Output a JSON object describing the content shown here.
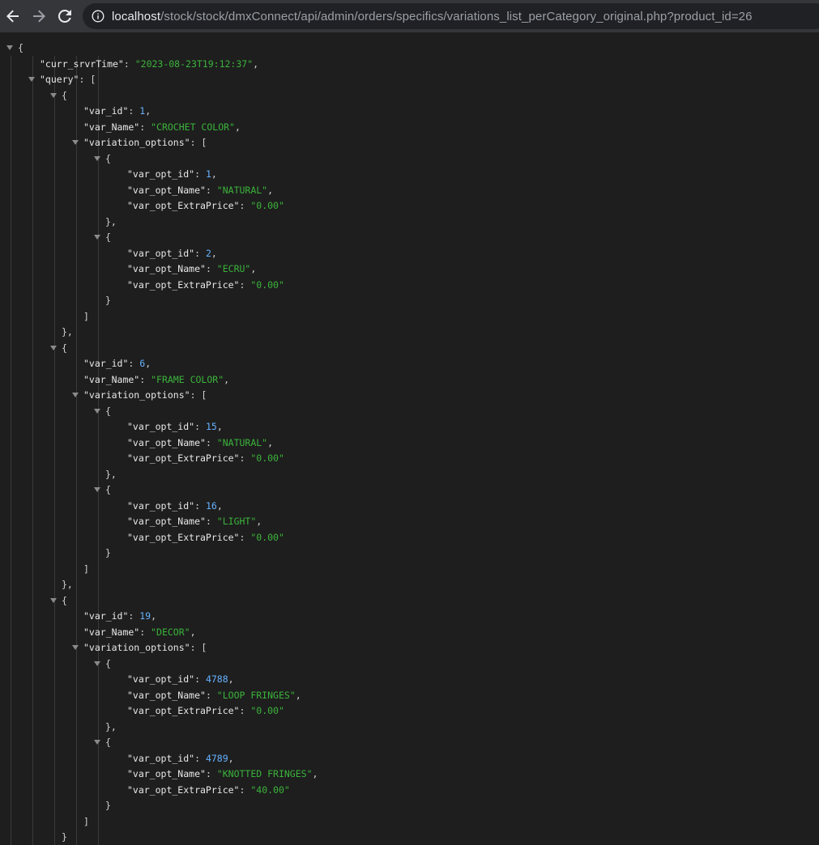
{
  "browser": {
    "url_host": "localhost",
    "url_path": "/stock/stock/dmxConnect/api/admin/orders/specifics/variations_list_perCategory_original.php?product_id=26"
  },
  "json": {
    "curr_srvrTime_key": "\"curr_srvrTime\"",
    "curr_srvrTime_value": "\"2023-08-23T19:12:37\"",
    "query_key": "\"query\"",
    "items": [
      {
        "var_id": "1",
        "var_Name": "\"CROCHET COLOR\"",
        "options": [
          {
            "id": "1",
            "name": "\"NATURAL\"",
            "price": "\"0.00\""
          },
          {
            "id": "2",
            "name": "\"ECRU\"",
            "price": "\"0.00\""
          }
        ]
      },
      {
        "var_id": "6",
        "var_Name": "\"FRAME COLOR\"",
        "options": [
          {
            "id": "15",
            "name": "\"NATURAL\"",
            "price": "\"0.00\""
          },
          {
            "id": "16",
            "name": "\"LIGHT\"",
            "price": "\"0.00\""
          }
        ]
      },
      {
        "var_id": "19",
        "var_Name": "\"DECOR\"",
        "options": [
          {
            "id": "4788",
            "name": "\"LOOP FRINGES\"",
            "price": "\"0.00\""
          },
          {
            "id": "4789",
            "name": "\"KNOTTED FRINGES\"",
            "price": "\"40.00\""
          }
        ]
      }
    ],
    "labels": {
      "var_id": "\"var_id\"",
      "var_Name": "\"var_Name\"",
      "variation_options": "\"variation_options\"",
      "var_opt_id": "\"var_opt_id\"",
      "var_opt_Name": "\"var_opt_Name\"",
      "var_opt_ExtraPrice": "\"var_opt_ExtraPrice\""
    }
  },
  "colors": {
    "key": "#e8e8e8",
    "number": "#66b2ff",
    "string": "#3bb33b",
    "background": "#1e1e1e"
  }
}
